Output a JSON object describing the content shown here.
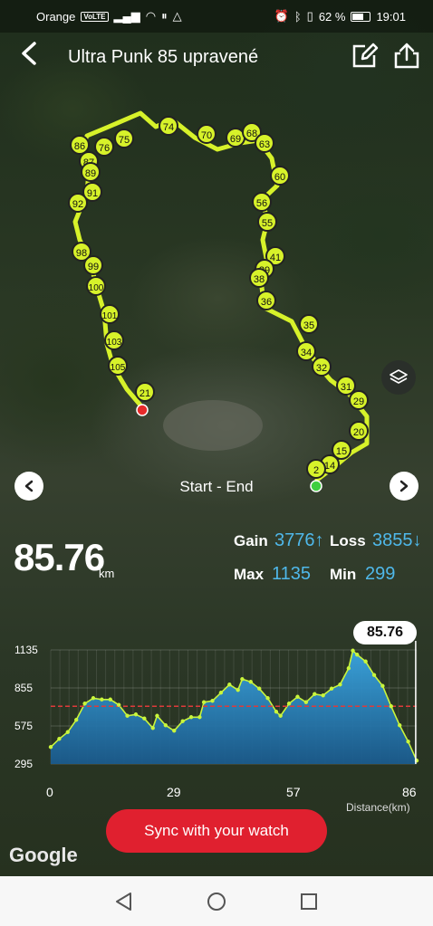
{
  "status_bar": {
    "carrier": "Orange",
    "volte": "VoLTE",
    "battery": "62 %",
    "time": "19:01"
  },
  "header": {
    "title": "Ultra Punk 85 upravené",
    "back_icon": "chevron-left-icon",
    "edit_icon": "edit-icon",
    "share_icon": "share-icon"
  },
  "map": {
    "route_color": "#d7f22a",
    "waypoint_labels": [
      "86",
      "87",
      "89",
      "76",
      "75",
      "74",
      "70",
      "69",
      "68",
      "63",
      "60",
      "56",
      "55",
      "41",
      "39",
      "38",
      "36",
      "35",
      "34",
      "32",
      "31",
      "29",
      "20",
      "15",
      "14",
      "2",
      "91",
      "92",
      "98",
      "99",
      "100",
      "101",
      "103",
      "105",
      "21"
    ],
    "layers_icon": "layers-icon",
    "start_marker_color": "#3fcf3f",
    "end_marker_color": "#e62a2a"
  },
  "segment": {
    "label": "Start - End",
    "prev_icon": "chevron-left-icon",
    "next_icon": "chevron-right-icon"
  },
  "stats": {
    "distance": "85.76",
    "distance_unit": "km",
    "gain_label": "Gain",
    "gain_value": "3776↑",
    "loss_label": "Loss",
    "loss_value": "3855↓",
    "max_label": "Max",
    "max_value": "1135",
    "min_label": "Min",
    "min_value": "299",
    "accent_color": "#4fb8ea"
  },
  "chart_data": {
    "type": "area",
    "badge": "85.76",
    "ytick_labels": [
      "1135",
      "855",
      "575",
      "295"
    ],
    "xtick_labels": [
      "0",
      "29",
      "57",
      "86"
    ],
    "xlabel": "Distance(km)",
    "ylim": [
      295,
      1135
    ],
    "xlim": [
      0,
      86
    ],
    "reference_line": 720,
    "x": [
      0,
      2,
      4,
      6,
      8,
      10,
      12,
      14,
      16,
      18,
      20,
      22,
      24,
      25,
      27,
      29,
      31,
      33,
      35,
      36,
      38,
      40,
      42,
      44,
      45,
      47,
      49,
      51,
      53,
      54,
      56,
      58,
      60,
      62,
      64,
      66,
      68,
      70,
      71,
      72,
      74,
      76,
      78,
      80,
      82,
      84,
      86
    ],
    "values": [
      420,
      480,
      530,
      620,
      740,
      780,
      770,
      770,
      730,
      650,
      660,
      630,
      560,
      650,
      580,
      540,
      610,
      640,
      640,
      750,
      760,
      820,
      880,
      840,
      920,
      900,
      850,
      780,
      680,
      650,
      740,
      790,
      750,
      810,
      800,
      850,
      880,
      1000,
      1130,
      1100,
      1050,
      950,
      870,
      720,
      580,
      460,
      320
    ]
  },
  "actions": {
    "sync_label": "Sync with your watch"
  },
  "branding": {
    "google": "Google"
  },
  "nav_bar": {
    "back_icon": "triangle-back-icon",
    "home_icon": "circle-home-icon",
    "recent_icon": "square-recent-icon"
  }
}
